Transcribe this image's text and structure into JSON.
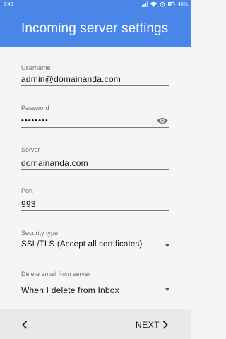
{
  "status_bar": {
    "time": "2:48",
    "battery_text": "40%",
    "icons": [
      "signal-icon",
      "wifi-icon",
      "alarm-icon",
      "battery-icon"
    ]
  },
  "header": {
    "title": "Incoming server settings",
    "color": "#4a86e8"
  },
  "form": {
    "username": {
      "label": "Username",
      "value": "admin@domainanda.com"
    },
    "password": {
      "label": "Password",
      "value": "••••••••"
    },
    "server": {
      "label": "Server",
      "value": "domainanda.com"
    },
    "port": {
      "label": "Port",
      "value": "993"
    },
    "security_type": {
      "label": "Security type",
      "value": "SSL/TLS (Accept all certificates)"
    },
    "delete_email": {
      "label": "Delete email from server",
      "value": "When I delete from Inbox"
    }
  },
  "bottom_bar": {
    "next_label": "NEXT",
    "icons": [
      "chevron-left-icon",
      "chevron-right-icon"
    ]
  }
}
